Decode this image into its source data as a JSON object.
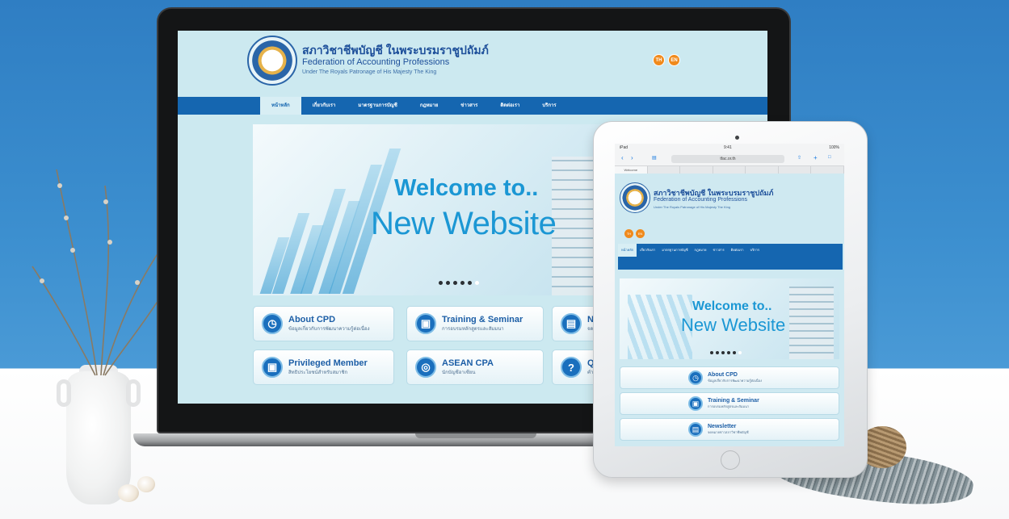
{
  "site": {
    "name_th": "สภาวิชาชีพบัญชี ในพระบรมราชูปถัมภ์",
    "name_en": "Federation of Accounting Professions",
    "name_sub": "Under The Royals Patronage of His Majesty The King",
    "lang": [
      "TH",
      "EN"
    ]
  },
  "nav": [
    "หน้าหลัก",
    "เกี่ยวกับเรา",
    "มาตรฐานการบัญชี",
    "กฎหมาย",
    "ข่าวสาร",
    "ติดต่อเรา",
    "บริการ"
  ],
  "hero": {
    "line1": "Welcome to..",
    "line2": "New Website",
    "slides": 6,
    "active_slide": 6
  },
  "services": [
    {
      "title": "About CPD",
      "sub": "ข้อมูลเกี่ยวกับการพัฒนาความรู้ต่อเนื่อง",
      "icon": "clock-icon"
    },
    {
      "title": "Training & Seminar",
      "sub": "การอบรมหลักสูตรและสัมมนา",
      "icon": "calendar-icon"
    },
    {
      "title": "No",
      "sub": "จดห",
      "icon": "book-icon"
    },
    {
      "title": "Privileged Member",
      "sub": "สิทธิประโยชน์สำหรับสมาชิก",
      "icon": "gift-icon"
    },
    {
      "title": "ASEAN CPA",
      "sub": "นักบัญชีอาเซียน",
      "icon": "coin-icon"
    },
    {
      "title": "Q",
      "sub": "คำถ",
      "icon": "question-icon"
    }
  ],
  "tablet": {
    "status_left": "iPad",
    "status_time": "9:41",
    "status_right": "100%",
    "url": "tfac.or.th",
    "tabs": [
      "Welcome",
      "",
      "",
      "",
      "",
      "",
      ""
    ],
    "services": [
      {
        "title": "About CPD",
        "sub": "ข้อมูลเกี่ยวกับการพัฒนาความรู้ต่อเนื่อง",
        "icon": "clock-icon"
      },
      {
        "title": "Training & Seminar",
        "sub": "การอบรมหลักสูตรและสัมมนา",
        "icon": "calendar-icon"
      },
      {
        "title": "Newsletter",
        "sub": "จดหมายข่าวสภาวิชาชีพบัญชี",
        "icon": "book-icon"
      }
    ]
  },
  "colors": {
    "brand_blue": "#1566b0",
    "accent_cyan": "#1b97d4",
    "lang_orange": "#f08a1c"
  }
}
